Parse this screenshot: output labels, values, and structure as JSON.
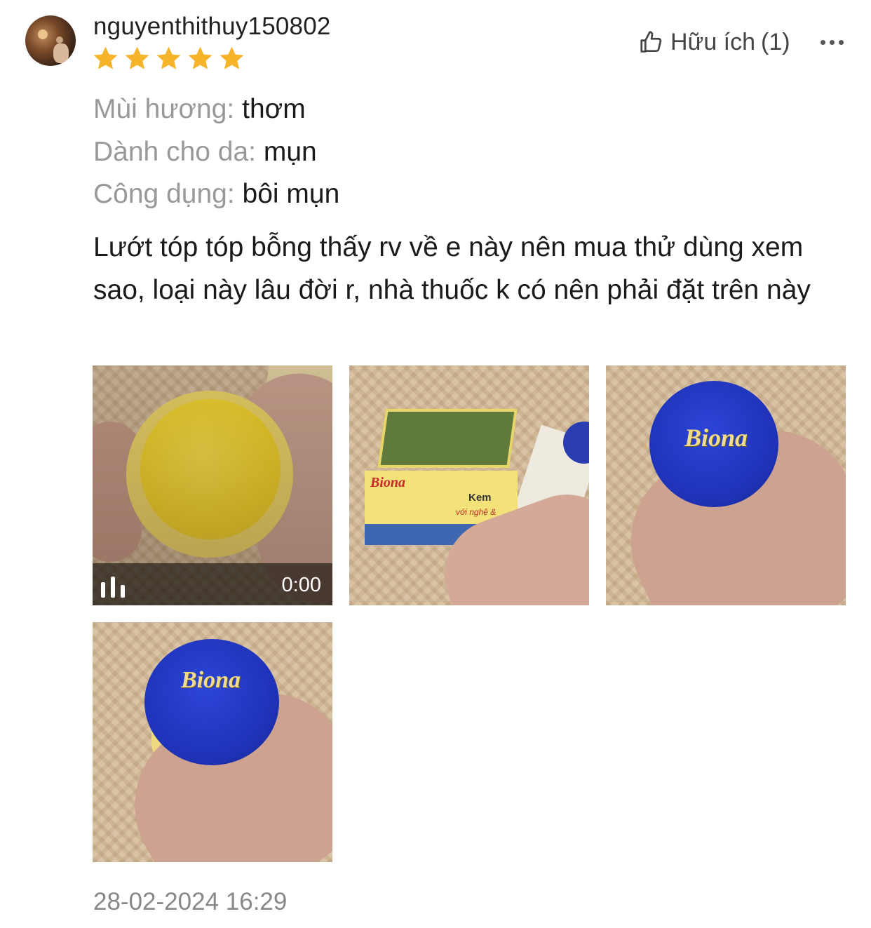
{
  "review": {
    "username": "nguyenthithuy150802",
    "rating": 5,
    "rating_max": 5,
    "star_color": "#F6B42A",
    "helpful": {
      "label": "Hữu ích",
      "count_text": "(1)",
      "icon": "thumbs-up-icon"
    },
    "more_icon": "more-icon",
    "attributes": [
      {
        "key": "Mùi hương:",
        "value": "thơm"
      },
      {
        "key": "Dành cho da:",
        "value": "mụn"
      },
      {
        "key": "Công dụng:",
        "value": "bôi mụn"
      }
    ],
    "text": "Lướt tóp tóp bỗng thấy rv về e này nên mua thử dùng xem sao, loại này lâu đời r, nhà thuốc k có nên phải đặt trên này",
    "media": [
      {
        "type": "video",
        "duration": "0:00"
      },
      {
        "type": "image"
      },
      {
        "type": "image",
        "lid_text": "Biona"
      },
      {
        "type": "image",
        "lid_text": "Biona"
      }
    ],
    "box_text": {
      "logo": "Biona",
      "title": "Kem",
      "sub": "với nghệ &"
    },
    "date": "28-02-2024 16:29"
  }
}
